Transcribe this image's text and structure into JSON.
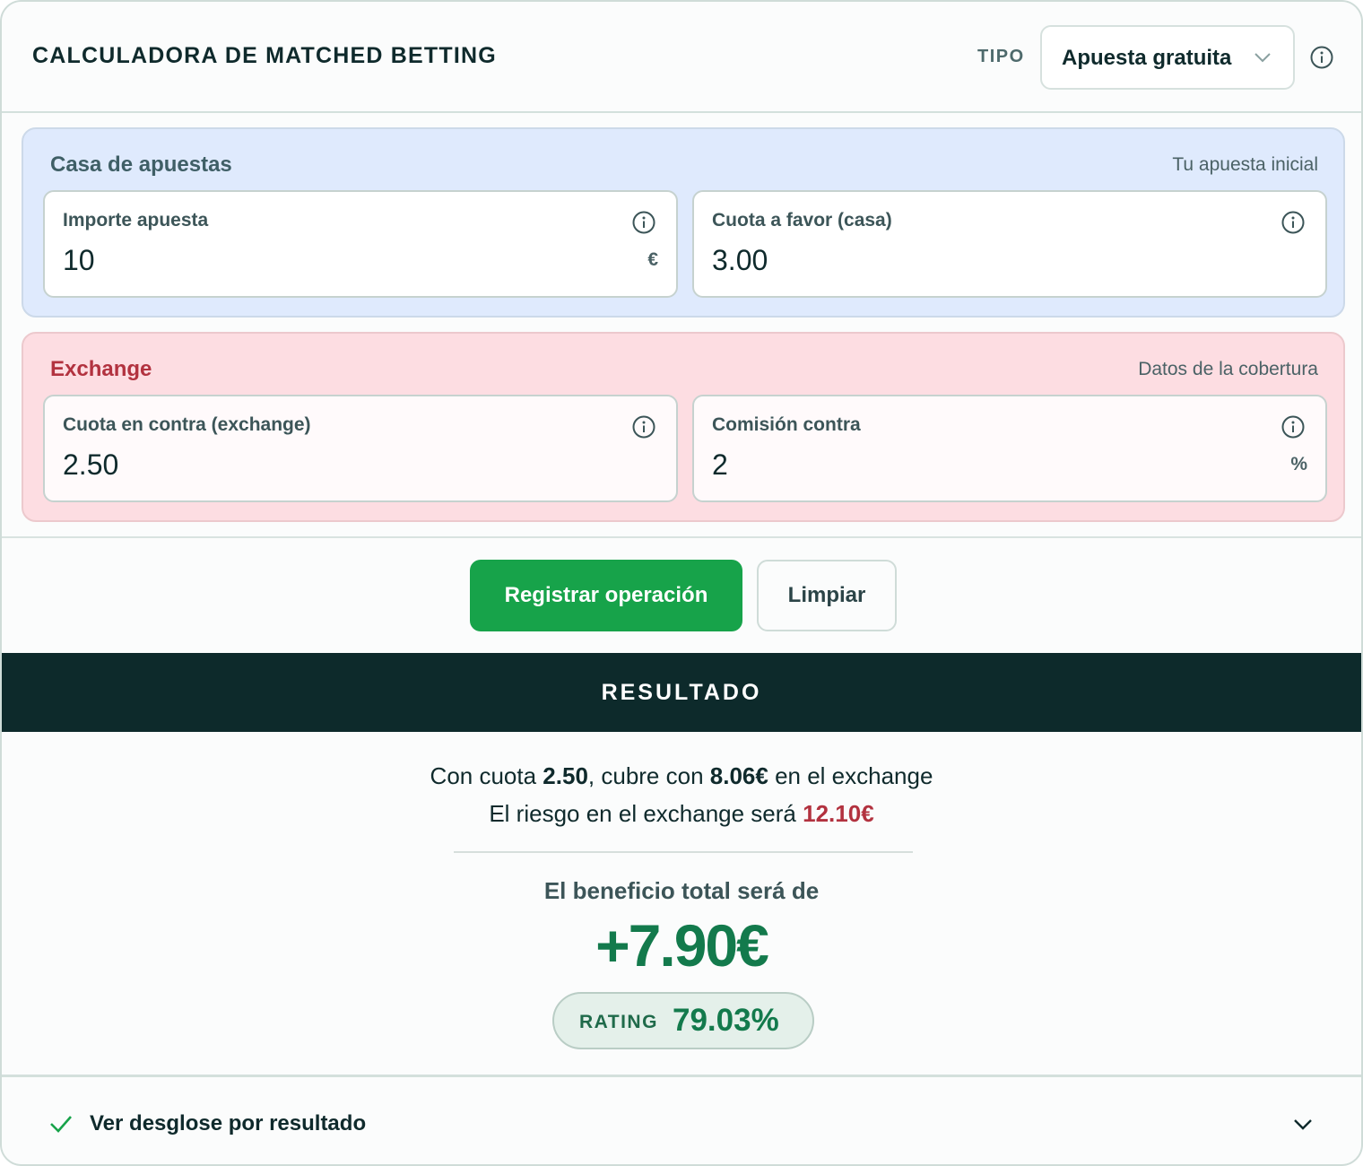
{
  "header": {
    "title": "CALCULADORA DE MATCHED BETTING",
    "tipo_label": "TIPO",
    "tipo_selected": "Apuesta gratuita"
  },
  "casa": {
    "title": "Casa de apuestas",
    "subtitle": "Tu apuesta inicial",
    "importe": {
      "label": "Importe apuesta",
      "value": "10",
      "unit": "€"
    },
    "cuota": {
      "label": "Cuota a favor (casa)",
      "value": "3.00"
    }
  },
  "exchange": {
    "title": "Exchange",
    "subtitle": "Datos de la cobertura",
    "cuota": {
      "label": "Cuota en contra (exchange)",
      "value": "2.50"
    },
    "comision": {
      "label": "Comisión contra",
      "value": "2",
      "unit": "%"
    }
  },
  "actions": {
    "register": "Registrar operación",
    "clear": "Limpiar"
  },
  "result": {
    "heading": "RESULTADO",
    "line1_a": "Con cuota ",
    "line1_odds": "2.50",
    "line1_b": ", cubre con ",
    "line1_stake": "8.06€",
    "line1_c": " en el exchange",
    "line2_a": "El riesgo en el exchange será ",
    "line2_risk": "12.10€",
    "benefit_label": "El beneficio total será de",
    "benefit_value": "+7.90€",
    "rating_label": "RATING",
    "rating_value": "79.03%"
  },
  "footer": {
    "breakdown_label": "Ver desglose por resultado"
  },
  "colors": {
    "accent_green": "#17a34a",
    "profit_green": "#137a4c",
    "risk_red": "#b2323f",
    "dark_band": "#0d2a2b"
  },
  "icons": [
    "info-icon",
    "chevron-down-icon",
    "check-icon"
  ]
}
